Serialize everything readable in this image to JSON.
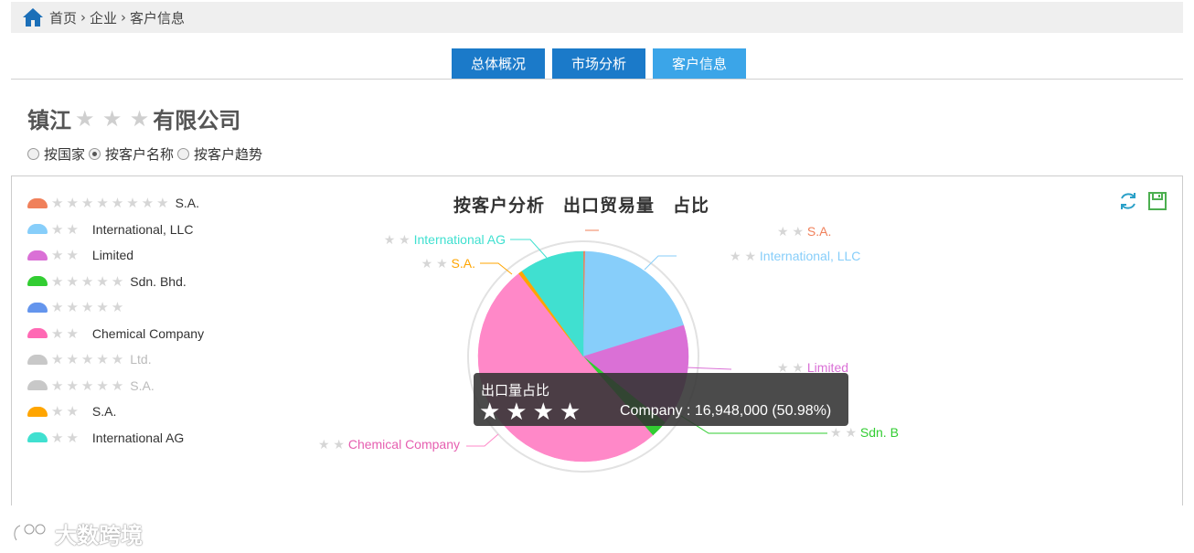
{
  "breadcrumb": {
    "items": [
      "首页",
      "企业",
      "客户信息"
    ],
    "sep": "›"
  },
  "tabs": [
    {
      "label": "总体概况",
      "active": false
    },
    {
      "label": "市场分析",
      "active": false
    },
    {
      "label": "客户信息",
      "active": true
    }
  ],
  "company": {
    "prefix": "镇江",
    "masked": "★ ★ ★",
    "suffix": "有限公司"
  },
  "view_options": [
    {
      "label": "按国家",
      "selected": false
    },
    {
      "label": "按客户名称",
      "selected": true
    },
    {
      "label": "按客户趋势",
      "selected": false
    }
  ],
  "legend": [
    {
      "stars": "★★★★★★★★",
      "text": "S.A.",
      "color": "#f0805a",
      "faded": false
    },
    {
      "stars": "★★",
      "text": "International, LLC",
      "color": "#87cefa",
      "faded": false
    },
    {
      "stars": "★★",
      "text": "Limited",
      "color": "#da70d6",
      "faded": false
    },
    {
      "stars": "★★★★★",
      "text": "Sdn. Bhd.",
      "color": "#32cd32",
      "faded": false
    },
    {
      "stars": "★★★★★",
      "text": "",
      "color": "#6495ed",
      "faded": false
    },
    {
      "stars": "★★",
      "text": "Chemical Company",
      "color": "#ff69b4",
      "faded": false
    },
    {
      "stars": "★★★★★",
      "text": "Ltd.",
      "color": "#c8c8c8",
      "faded": true
    },
    {
      "stars": "★★★★★",
      "text": "S.A.",
      "color": "#c8c8c8",
      "faded": true
    },
    {
      "stars": "★★",
      "text": "S.A.",
      "color": "#ffa500",
      "faded": false
    },
    {
      "stars": "★★",
      "text": "International AG",
      "color": "#40e0d0",
      "faded": false
    }
  ],
  "chart_data": {
    "type": "pie",
    "title": "按客户分析　出口贸易量　占比",
    "slices": [
      {
        "name": "S.A.",
        "percent": 0.3,
        "color": "#f0805a",
        "label": "S.A.",
        "label_stars": "★ ★"
      },
      {
        "name": "International, LLC",
        "percent": 19.9,
        "color": "#87cefa",
        "label": "International, LLC",
        "label_stars": "★ ★"
      },
      {
        "name": "Limited",
        "percent": 15.6,
        "color": "#da70d6",
        "label": "Limited",
        "label_stars": "★ ★"
      },
      {
        "name": "Sdn. Bhd.",
        "percent": 2.7,
        "color": "#32cd32",
        "label": "Sdn. B",
        "label_stars": "★ ★"
      },
      {
        "name": "Chemical Company",
        "percent": 50.98,
        "color": "#ff88c8",
        "label": "Chemical Company",
        "label_stars": "★ ★"
      },
      {
        "name": "S.A.",
        "percent": 0.6,
        "color": "#ffa500",
        "label": "S.A.",
        "label_stars": "★ ★"
      },
      {
        "name": "International AG",
        "percent": 9.9,
        "color": "#40e0d0",
        "label": "International AG",
        "label_stars": "★ ★"
      }
    ]
  },
  "tooltip": {
    "title": "出口量占比",
    "stars": "★★★★",
    "value": "Company : 16,948,000 (50.98%)"
  },
  "watermark": {
    "text": "大数跨境"
  }
}
